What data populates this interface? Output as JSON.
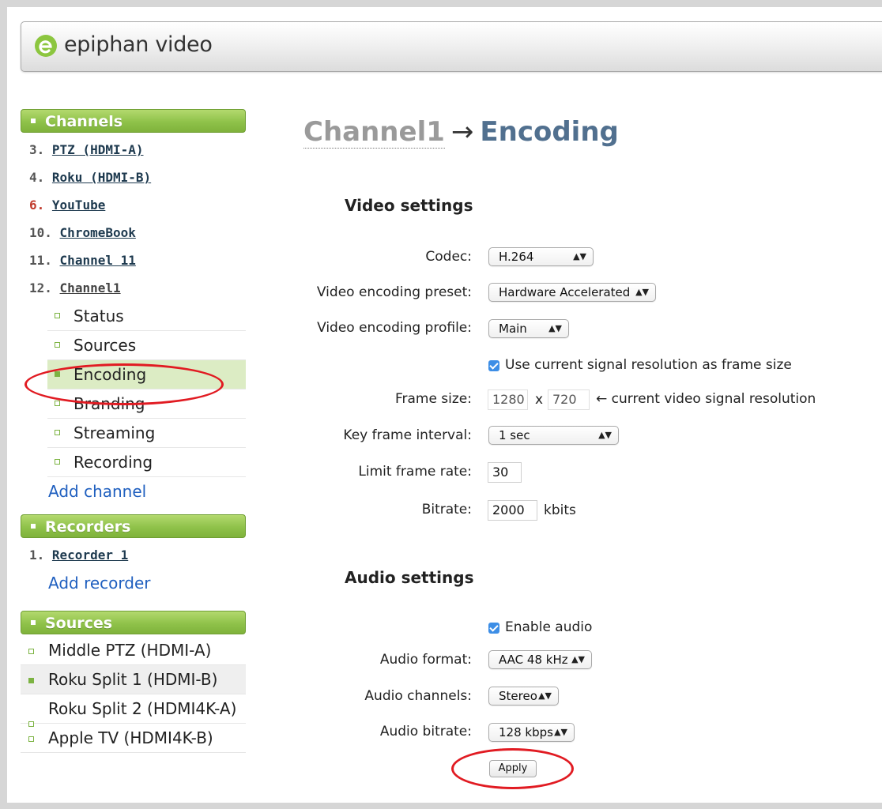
{
  "brand": {
    "name": "epiphan video"
  },
  "sidebar": {
    "channels_header": "Channels",
    "channels": [
      {
        "num": "3.",
        "name": "PTZ (HDMI-A)"
      },
      {
        "num": "4.",
        "name": "Roku (HDMI-B)"
      },
      {
        "num": "6.",
        "name": "YouTube"
      },
      {
        "num": "10.",
        "name": "ChromeBook"
      },
      {
        "num": "11.",
        "name": "Channel 11"
      },
      {
        "num": "12.",
        "name": "Channel1"
      }
    ],
    "channel_menu": [
      "Status",
      "Sources",
      "Encoding",
      "Branding",
      "Streaming",
      "Recording"
    ],
    "add_channel": "Add channel",
    "recorders_header": "Recorders",
    "recorders": [
      {
        "num": "1.",
        "name": "Recorder 1"
      }
    ],
    "add_recorder": "Add recorder",
    "sources_header": "Sources",
    "sources": [
      "Middle PTZ (HDMI-A)",
      "Roku Split 1 (HDMI-B)",
      "Roku Split 2 (HDMI4K-A)",
      "Apple TV (HDMI4K-B)"
    ]
  },
  "page": {
    "breadcrumb": "Channel1",
    "arrow": "→",
    "title": "Encoding"
  },
  "video": {
    "section_title": "Video settings",
    "codec_label": "Codec:",
    "codec_value": "H.264",
    "preset_label": "Video encoding preset:",
    "preset_value": "Hardware Accelerated",
    "profile_label": "Video encoding profile:",
    "profile_value": "Main",
    "use_current_label": "Use current signal resolution as frame size",
    "frame_size_label": "Frame size:",
    "frame_width": "1280",
    "frame_x": "x",
    "frame_height": "720",
    "frame_note": "← current video signal resolution",
    "keyframe_label": "Key frame interval:",
    "keyframe_value": "1 sec",
    "limit_fps_label": "Limit frame rate:",
    "limit_fps_value": "30",
    "bitrate_label": "Bitrate:",
    "bitrate_value": "2000",
    "bitrate_unit": "kbits"
  },
  "audio": {
    "section_title": "Audio settings",
    "enable_label": "Enable audio",
    "format_label": "Audio format:",
    "format_value": "AAC 48 kHz",
    "channels_label": "Audio channels:",
    "channels_value": "Stereo",
    "bitrate_label": "Audio bitrate:",
    "bitrate_value": "128 kbps"
  },
  "apply_label": "Apply",
  "select_arrows": "▲▼",
  "colors": {
    "accent_green": "#8fc24a",
    "link_blue": "#1f5fbf",
    "title_blue": "#51708f",
    "annotation_red": "#e11b22"
  }
}
